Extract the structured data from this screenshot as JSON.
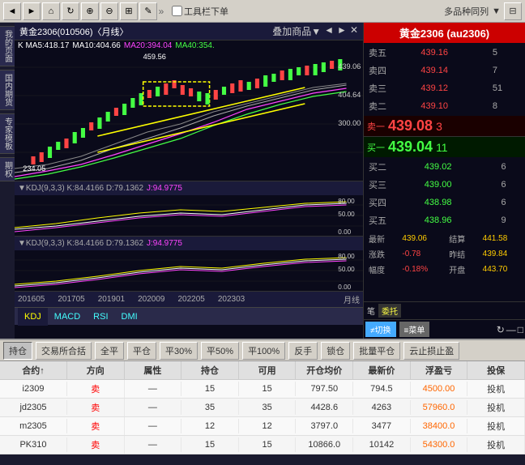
{
  "toolbar": {
    "checkbox_label": "工具栏下单",
    "dropdown_label": "多品种同列",
    "add_commodity": "叠加商品▼"
  },
  "chart": {
    "title": "黄金2306(010506)〈月线〉",
    "ma5": "K MA5:418.17",
    "ma10": "MA10:404.66",
    "ma20": "MA20:394.04",
    "ma40": "MA40:354.",
    "price_high": "459.56",
    "price_1": "439.06",
    "price_2": "404.64",
    "price_3": "300.00",
    "price_4": "234.05",
    "price_5": "80.00",
    "price_6": "0.00",
    "kdj_label1": "KDJ(9,3,3) K:84.4166 D:79.1362",
    "kdj_j1": "J:94.9775",
    "kdj_val1_80": "80.00",
    "kdj_val1_50": "50.00",
    "kdj_val1_0": "0.00",
    "kdj_label2": "KDJ(9,3,3) K:84.4166 D:79.1362",
    "kdj_j2": "J:94.9775",
    "kdj_val2_80": "80.00",
    "kdj_val2_50": "50.00",
    "kdj_val2_0": "0.00",
    "dates": [
      "201605",
      "201705",
      "201901",
      "202009",
      "202205",
      "202303"
    ],
    "period_label": "月线",
    "bottom_tabs": [
      "KDJ",
      "MACD",
      "RSI",
      "DMI"
    ]
  },
  "right_panel": {
    "title": "黄金2306 (au2306)",
    "asks": [
      {
        "level": "卖五",
        "price": "439.16",
        "qty": "5"
      },
      {
        "level": "卖四",
        "price": "439.14",
        "qty": "7"
      },
      {
        "level": "卖三",
        "price": "439.12",
        "qty": "51"
      },
      {
        "level": "卖二",
        "price": "439.10",
        "qty": "8"
      },
      {
        "level": "卖一",
        "price": "439.08",
        "qty": "3"
      }
    ],
    "sell_one_label": "卖一",
    "sell_one_price": "439.08",
    "sell_one_qty": "3",
    "buy_one_label": "买一",
    "buy_one_price": "439.04",
    "buy_one_qty": "11",
    "bids": [
      {
        "level": "买二",
        "price": "439.02",
        "qty": "6"
      },
      {
        "level": "买三",
        "price": "439.00",
        "qty": "6"
      },
      {
        "level": "买四",
        "price": "438.98",
        "qty": "6"
      },
      {
        "level": "买五",
        "price": "438.96",
        "qty": "9"
      }
    ],
    "stats": [
      {
        "label": "最新",
        "value": "439.06",
        "label2": "结算",
        "value2": "441.58"
      },
      {
        "label": "涨跌",
        "value": "-0.78",
        "label2": "昨结",
        "value2": "439.84"
      },
      {
        "label": "幅度",
        "value": "-0.18%",
        "label2": "开盘",
        "value2": "443.70"
      }
    ],
    "笔": "笔",
    "委托": "委托",
    "switch_btn": "≠切换",
    "menu_btn": "≡菜单"
  },
  "trading": {
    "tabs": [
      "持仓",
      "交易所合括",
      "全平",
      "平仓",
      "平30%",
      "平50%",
      "平100%",
      "反手",
      "锁仓",
      "批量平仓",
      "云止损止盈"
    ],
    "columns": [
      "合约↑",
      "方向",
      "属性",
      "持仓",
      "可用",
      "开仓均价",
      "最新价",
      "浮盈亏",
      "投保"
    ],
    "rows": [
      {
        "contract": "i2309",
        "direction": "卖",
        "property": "—",
        "position": "15",
        "available": "15",
        "avg_price": "797.50",
        "latest": "794.5",
        "float_pnl": "4500.00",
        "type": "投机"
      },
      {
        "contract": "jd2305",
        "direction": "卖",
        "property": "—",
        "position": "35",
        "available": "35",
        "avg_price": "4428.6",
        "latest": "4263",
        "float_pnl": "57960.0",
        "type": "投机"
      },
      {
        "contract": "m2305",
        "direction": "卖",
        "property": "—",
        "position": "12",
        "available": "12",
        "avg_price": "3797.0",
        "latest": "3477",
        "float_pnl": "38400.0",
        "type": "投机"
      },
      {
        "contract": "PK310",
        "direction": "卖",
        "property": "—",
        "position": "15",
        "available": "15",
        "avg_price": "10866.0",
        "latest": "10142",
        "float_pnl": "54300.0",
        "type": "投机"
      }
    ]
  }
}
